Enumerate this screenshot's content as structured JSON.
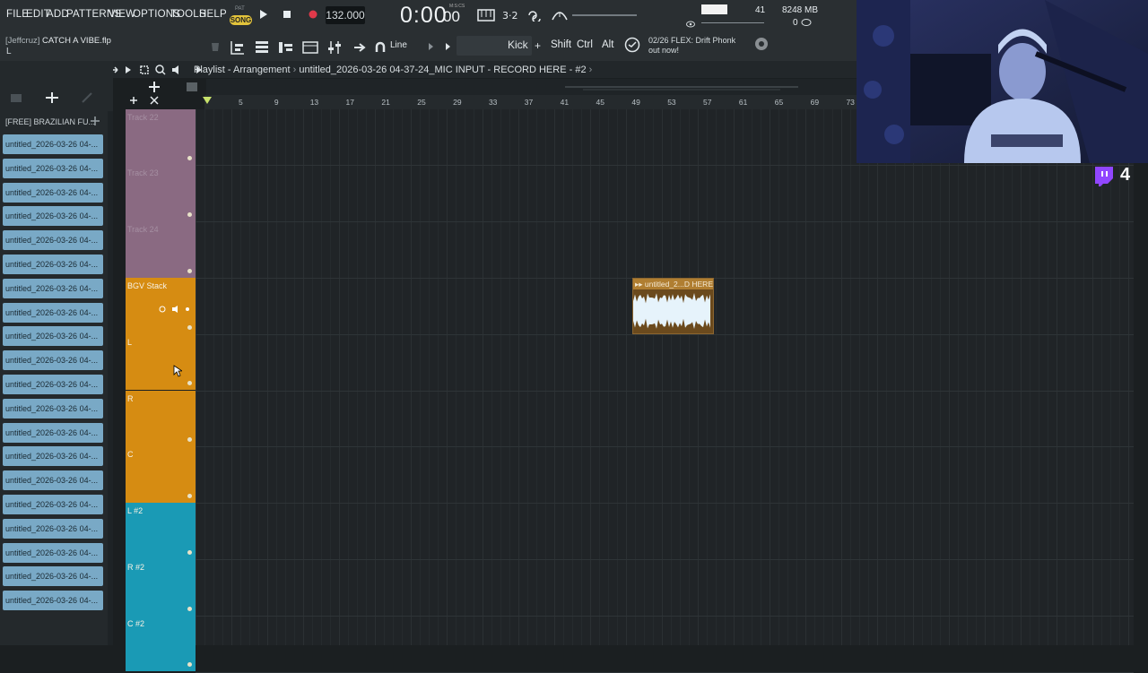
{
  "menu": [
    "FILE",
    "EDIT",
    "ADD",
    "PATTERNS",
    "VIEW",
    "OPTIONS",
    "TOOLS",
    "HELP"
  ],
  "transport": {
    "mode_small": "PAT",
    "mode": "SONG",
    "tempo": "132.000",
    "time": "0:00",
    "time_frac": "00",
    "time_unit": "M:S:CS"
  },
  "monitor": {
    "cpu": "41",
    "memory": "8248 MB",
    "polyphony": "0"
  },
  "project": {
    "author": "[Jeffcruz]",
    "name": "CATCH A VIBE.flp",
    "hint": "L"
  },
  "toolbar2": {
    "snap": "Line",
    "instrument": "Kick",
    "mod_keys": [
      "Shift",
      "Ctrl",
      "Alt"
    ],
    "news_counter": "02/26",
    "news_line1": "FLEX: Drift Phonk",
    "news_line2": "out now!"
  },
  "playlist": {
    "title": "Playlist - Arrangement",
    "pattern": "untitled_2026-03-26 04-37-24_MIC INPUT - RECORD HERE - #2",
    "ruler": [
      "5",
      "9",
      "13",
      "17",
      "21",
      "25",
      "29",
      "33",
      "37",
      "41",
      "45",
      "49",
      "53",
      "57",
      "61",
      "65",
      "69",
      "73"
    ]
  },
  "browser": {
    "header": "[FREE] BRAZILIAN FU...",
    "items": [
      "untitled_2026-03-26 04-...",
      "untitled_2026-03-26 04-...",
      "untitled_2026-03-26 04-...",
      "untitled_2026-03-26 04-...",
      "untitled_2026-03-26 04-...",
      "untitled_2026-03-26 04-...",
      "untitled_2026-03-26 04-...",
      "untitled_2026-03-26 04-...",
      "untitled_2026-03-26 04-...",
      "untitled_2026-03-26 04-...",
      "untitled_2026-03-26 04-...",
      "untitled_2026-03-26 04-...",
      "untitled_2026-03-26 04-...",
      "untitled_2026-03-26 04-...",
      "untitled_2026-03-26 04-...",
      "untitled_2026-03-26 04-...",
      "untitled_2026-03-26 04-...",
      "untitled_2026-03-26 04-...",
      "untitled_2026-03-26 04-...",
      "untitled_2026-03-26 04-..."
    ]
  },
  "tracks": [
    {
      "label": "Track 22",
      "color": "#8a6a82"
    },
    {
      "label": "Track 23",
      "color": "#8a6a82"
    },
    {
      "label": "Track 24",
      "color": "#8a6a82"
    },
    {
      "label": "BGV Stack",
      "color": "#d68c12"
    },
    {
      "label": "L",
      "color": "#d68c12"
    },
    {
      "label": "R",
      "color": "#d68c12"
    },
    {
      "label": "C",
      "color": "#d68c12"
    },
    {
      "label": "L #2",
      "color": "#1a9ab5"
    },
    {
      "label": "R #2",
      "color": "#1a9ab5"
    },
    {
      "label": "C #2",
      "color": "#1a9ab5"
    }
  ],
  "clip": {
    "title": "untitled_2...D HERE -"
  },
  "stream": {
    "viewers": "4"
  },
  "colors": {
    "song_badge": "#e2c33b",
    "group_purple": "#8a6a82",
    "group_orange": "#d68c12",
    "group_teal": "#1a9ab5",
    "browser_item": "#79a9c6"
  }
}
